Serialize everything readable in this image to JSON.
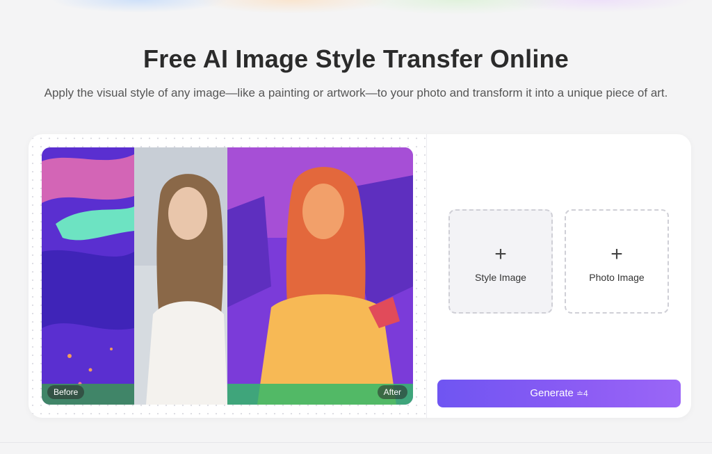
{
  "page": {
    "title": "Free AI Image Style Transfer Online",
    "subtitle": "Apply the visual style of any image—like a painting or artwork—to your photo and transform it into a unique piece of art."
  },
  "preview": {
    "before_label": "Before",
    "after_label": "After"
  },
  "uploads": {
    "style_label": "Style Image",
    "photo_label": "Photo Image",
    "plus_glyph": "+"
  },
  "generate": {
    "label": "Generate",
    "credit_text": "≐4"
  },
  "colors": {
    "accent": "#7b5cf4",
    "title_text": "#2b2b2b"
  }
}
